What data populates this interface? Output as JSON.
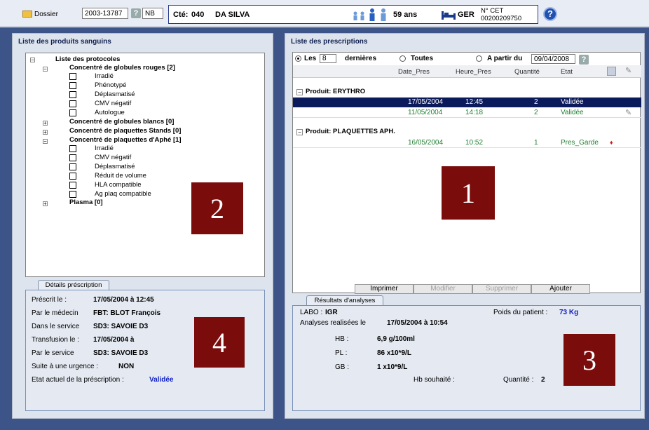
{
  "topbar": {
    "dossier_label": "Dossier",
    "dossier_number": "2003-13787",
    "nb_field": "NB",
    "cte_label": "Cté:",
    "cte_value": "040",
    "patient_name": "DA SILVA",
    "age": "59 ans",
    "ger_label": "GER",
    "cet_label": "N° CET",
    "cet_number": "00200209750"
  },
  "left_panel": {
    "title": "Liste des produits sanguins",
    "tree": {
      "root": "Liste des protocoles",
      "gr": "Concentré de globules rouges [2]",
      "gr_items": [
        "Irradié",
        "Phénotypé",
        "Déplasmatisé",
        "CMV négatif",
        "Autologue"
      ],
      "gb": "Concentré de globules blancs [0]",
      "cps": "Concentré de plaquettes Stands [0]",
      "cpa": "Concentré de plaquettes d'Aphé [1]",
      "cpa_items": [
        "Irradié",
        "CMV négatif",
        "Déplasmatisé",
        "Réduit de volume",
        "HLA compatible",
        "Ag plaq compatible"
      ],
      "plasma": "Plasma [0]"
    },
    "marker": "2"
  },
  "details": {
    "tab": "Détails préscription",
    "prescrit_label": "Préscrit le :",
    "prescrit_value": "17/05/2004 à 12:45",
    "medecin_label": "Par le médecin",
    "medecin_value": "FBT: BLOT François",
    "service_label": "Dans le service",
    "service_value": "SD3: SAVOIE D3",
    "transfusion_label": "Transfusion le :",
    "transfusion_value": "17/05/2004 à",
    "par_service_label": "Par le service",
    "par_service_value": "SD3: SAVOIE D3",
    "urgence_label": "Suite à une urgence :",
    "urgence_value": "NON",
    "etat_label": "Etat actuel de la préscription :",
    "etat_value": "Validée",
    "marker": "4"
  },
  "right_panel": {
    "title": "Liste des prescriptions",
    "filter": {
      "les_label": "Les",
      "les_value": "8",
      "dernieres_label": "dernières",
      "toutes_label": "Toutes",
      "apartir_label": "A partir du",
      "date_value": "09/04/2008"
    },
    "columns": [
      "Date_Pres",
      "Heure_Pres",
      "Quantité",
      "Etat"
    ],
    "groups": [
      {
        "product": "Produit: ERYTHRO",
        "rows": [
          {
            "date": "17/05/2004",
            "heure": "12:45",
            "qte": "2",
            "etat": "Validée"
          },
          {
            "date": "11/05/2004",
            "heure": "14:18",
            "qte": "2",
            "etat": "Validée"
          }
        ]
      },
      {
        "product": "Produit: PLAQUETTES APH.",
        "rows": [
          {
            "date": "16/05/2004",
            "heure": "10:52",
            "qte": "1",
            "etat": "Pres_Garde"
          }
        ]
      }
    ],
    "buttons": {
      "imprimer": "Imprimer",
      "modifier": "Modifier",
      "supprimer": "Supprimer",
      "ajouter": "Ajouter"
    },
    "marker": "1"
  },
  "results": {
    "tab": "Résultats d'analyses",
    "labo_label": "LABO :",
    "labo_value": "IGR",
    "poids_label": "Poids du patient :",
    "poids_value": "73 Kg",
    "analyses_label": "Analyses realisées le",
    "analyses_value": "17/05/2004 à 10:54",
    "hb_label": "HB :",
    "hb_value": "6,9 g/100ml",
    "pl_label": "PL :",
    "pl_value": "86 x10*9/L",
    "gb_label": "GB :",
    "gb_value": "1 x10*9/L",
    "hb_souhaite_label": "Hb souhaité :",
    "quantite_label": "Quantité :",
    "quantite_value": "2",
    "marker": "3"
  },
  "colors": {
    "accent": "#7a0c0c",
    "selected_row": "#0a1a5a",
    "valid_green": "#208030"
  }
}
